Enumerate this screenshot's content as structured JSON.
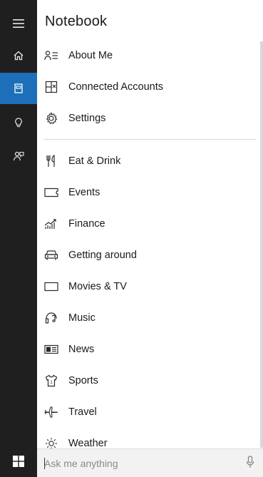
{
  "panel": {
    "title": "Notebook"
  },
  "rail": {
    "items": [
      {
        "name": "menu",
        "icon": "hamburger-icon",
        "active": false
      },
      {
        "name": "home",
        "icon": "home-icon",
        "active": false
      },
      {
        "name": "notebook",
        "icon": "notebook-icon",
        "active": true
      },
      {
        "name": "reminders",
        "icon": "lightbulb-icon",
        "active": false
      },
      {
        "name": "feedback",
        "icon": "feedback-icon",
        "active": false
      }
    ],
    "accent_color": "#1c6fb8",
    "background_color": "#1f1f1f"
  },
  "account_items": [
    {
      "label": "About Me",
      "icon": "about-me-icon"
    },
    {
      "label": "Connected Accounts",
      "icon": "connected-accounts-icon"
    },
    {
      "label": "Settings",
      "icon": "gear-icon"
    }
  ],
  "interest_items": [
    {
      "label": "Eat & Drink",
      "icon": "fork-knife-icon"
    },
    {
      "label": "Events",
      "icon": "ticket-icon"
    },
    {
      "label": "Finance",
      "icon": "finance-chart-icon"
    },
    {
      "label": "Getting around",
      "icon": "car-icon"
    },
    {
      "label": "Movies & TV",
      "icon": "screen-icon"
    },
    {
      "label": "Music",
      "icon": "music-icon"
    },
    {
      "label": "News",
      "icon": "newspaper-icon"
    },
    {
      "label": "Sports",
      "icon": "jersey-icon"
    },
    {
      "label": "Travel",
      "icon": "airplane-icon"
    },
    {
      "label": "Weather",
      "icon": "sun-icon"
    }
  ],
  "search": {
    "placeholder": "Ask me anything",
    "value": ""
  },
  "taskbar": {
    "start_icon": "windows-logo-icon",
    "mic_icon": "microphone-icon"
  }
}
